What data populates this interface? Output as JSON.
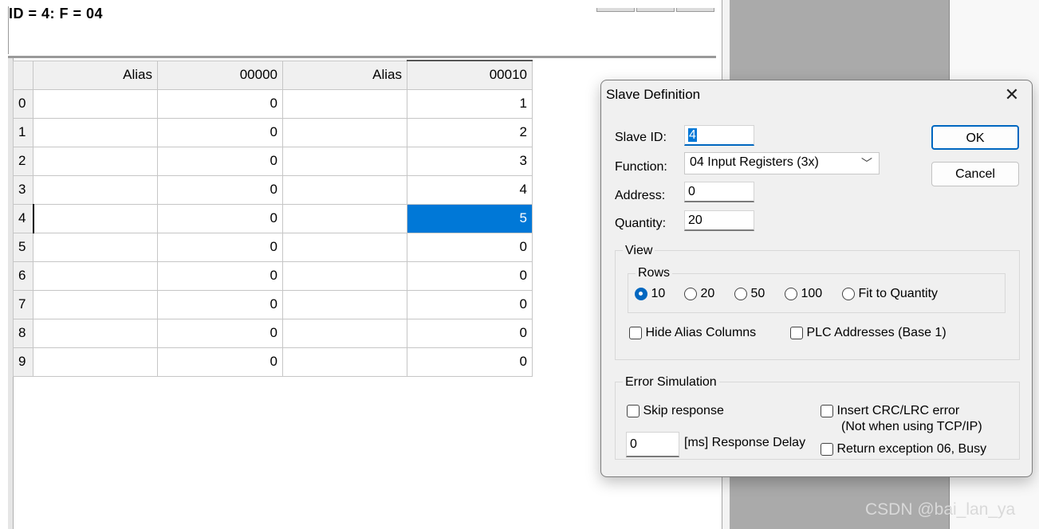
{
  "main": {
    "header": "ID = 4: F = 04"
  },
  "grid": {
    "headers": [
      "Alias",
      "00000",
      "Alias",
      "00010"
    ],
    "row_labels": [
      "0",
      "1",
      "2",
      "3",
      "4",
      "5",
      "6",
      "7",
      "8",
      "9"
    ],
    "col1_values": [
      "0",
      "0",
      "0",
      "0",
      "0",
      "0",
      "0",
      "0",
      "0",
      "0"
    ],
    "col2_values": [
      "1",
      "2",
      "3",
      "4",
      "5",
      "0",
      "0",
      "0",
      "0",
      "0"
    ],
    "selected_row": 4
  },
  "dialog": {
    "title": "Slave Definition",
    "close_glyph": "✕",
    "slave_id_label": "Slave ID:",
    "slave_id_value": "4",
    "function_label": "Function:",
    "function_value": "04 Input Registers (3x)",
    "address_label": "Address:",
    "address_value": "0",
    "quantity_label": "Quantity:",
    "quantity_value": "20",
    "ok_label": "OK",
    "cancel_label": "Cancel",
    "view": {
      "title": "View",
      "rows_title": "Rows",
      "row_options": [
        "10",
        "20",
        "50",
        "100",
        "Fit to Quantity"
      ],
      "selected_row_option": "10",
      "hide_alias_label": "Hide Alias Columns",
      "hide_alias_checked": false,
      "plc_addresses_label": "PLC Addresses (Base 1)",
      "plc_addresses_checked": false
    },
    "error_simulation": {
      "title": "Error Simulation",
      "skip_response_label": "Skip response",
      "skip_response_checked": false,
      "insert_crc_label": "Insert CRC/LRC error",
      "insert_crc_note": "(Not when using TCP/IP)",
      "insert_crc_checked": false,
      "response_delay_value": "0",
      "response_delay_label": "[ms] Response Delay",
      "return_exception_label": "Return exception 06, Busy",
      "return_exception_checked": false
    }
  },
  "watermark": "CSDN @bai_lan_ya",
  "colors": {
    "selection": "#0078d7",
    "accent": "#0067c0"
  }
}
